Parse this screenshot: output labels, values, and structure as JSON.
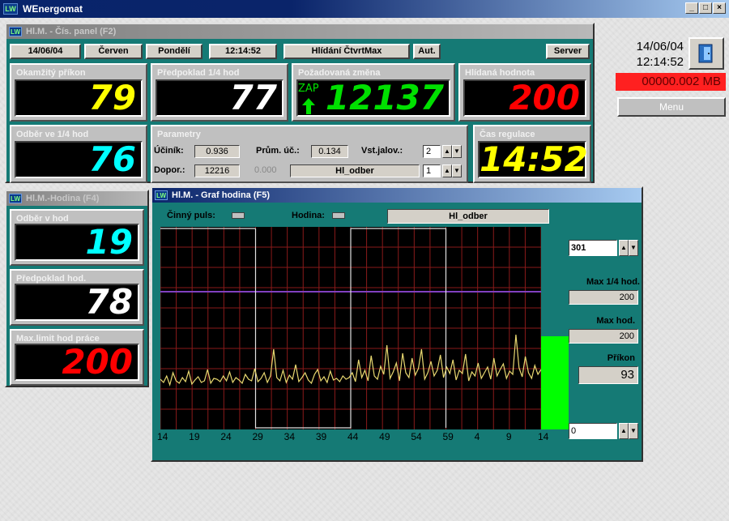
{
  "app": {
    "title": "WEnergomat",
    "icon": "LW",
    "window_controls": [
      "_",
      "□",
      "×"
    ]
  },
  "clock": {
    "date": "14/06/04",
    "time": "12:14:52"
  },
  "status": {
    "memory": "00000.002 MB"
  },
  "menu_label": "Menu",
  "panel1": {
    "title": "Hl.M. - Čís. panel (F2)",
    "header": {
      "date": "14/06/04",
      "month": "Červen",
      "day": "Pondělí",
      "time": "12:14:52",
      "mode": "Hlídání ČtvrtMax",
      "aut": "Aut.",
      "server": "Server"
    },
    "tiles": {
      "instant": {
        "label": "Okamžitý příkon",
        "value": "79",
        "color": "#ffff00"
      },
      "forecast": {
        "label": "Předpoklad 1/4 hod",
        "value": "77",
        "color": "#ffffff"
      },
      "required": {
        "label": "Požadovaná změna",
        "value": "12137",
        "color": "#00e000",
        "state": "ZAP"
      },
      "limit": {
        "label": "Hlídaná hodnota",
        "value": "200",
        "color": "#ff0000"
      },
      "consumption": {
        "label": "Odběr ve 1/4 hod",
        "value": "76",
        "color": "#00ffff"
      },
      "reg_time": {
        "label": "Čas regulace",
        "value": "14:52",
        "color": "#ffff00"
      }
    },
    "params": {
      "title": "Parametry",
      "pf_label": "Účiník:",
      "pf_value": "0.936",
      "avg_pf_label": "Prům. úč.:",
      "avg_pf_value": "0.134",
      "input_label": "Vst.jalov.:",
      "input_value": "2",
      "recommended_label": "Dopor.:",
      "recommended_value": "12216",
      "gray_value": "0.000",
      "source": "Hl_odber",
      "source_value": "1"
    }
  },
  "panel2": {
    "title": "Hl.M.-Hodina (F4)",
    "tiles": [
      {
        "label": "Odběr v hod",
        "value": "19",
        "color": "#00ffff"
      },
      {
        "label": "Předpoklad hod.",
        "value": "78",
        "color": "#ffffff"
      },
      {
        "label": "Max.limit hod práce",
        "value": "200",
        "color": "#ff0000"
      }
    ]
  },
  "panel3": {
    "title": "Hl.M. - Graf hodina (F5)",
    "active_pulse_label": "Činný puls:",
    "hour_label": "Hodina:",
    "source": "Hl_odber",
    "channel": "301",
    "max_quarter_label": "Max 1/4 hod.",
    "max_quarter_value": "200",
    "max_hour_label": "Max hod.",
    "max_hour_value": "200",
    "power_label": "Příkon",
    "power_value": "93",
    "bottom_value": "0",
    "bar_level_pct": 46
  },
  "chart_data": {
    "type": "line",
    "x_ticks": [
      "14",
      "19",
      "24",
      "29",
      "34",
      "39",
      "44",
      "49",
      "54",
      "59",
      "4",
      "9",
      "14"
    ],
    "ylim": [
      0,
      250
    ],
    "limit_line": 170,
    "grid": true,
    "series": [
      {
        "values": [
          62,
          58,
          66,
          55,
          70,
          60,
          57,
          64,
          59,
          72,
          56,
          61,
          65,
          58,
          60,
          74,
          57,
          63,
          62,
          59,
          66,
          60,
          71,
          58,
          64,
          61,
          57,
          68,
          62,
          60,
          75,
          59,
          63,
          70,
          58,
          66,
          99,
          64,
          60,
          73,
          58,
          67,
          62,
          80,
          59,
          64,
          70,
          61,
          57,
          68,
          74,
          60,
          65,
          58,
          72,
          61,
          63,
          59,
          66,
          62,
          64,
          70,
          59,
          86,
          64,
          73,
          60,
          91,
          66,
          62,
          78,
          68,
          104,
          63,
          71,
          82,
          60,
          94,
          70,
          64,
          88,
          67,
          75,
          99,
          62,
          70,
          84,
          66,
          73,
          92,
          64,
          77,
          69,
          86,
          61,
          73,
          69,
          93,
          60,
          71,
          66,
          82,
          63,
          70,
          77,
          62,
          88,
          66,
          74,
          81,
          63,
          72,
          68,
          117,
          76,
          65,
          90,
          70,
          63,
          79,
          68,
          74
        ]
      }
    ],
    "pulse_edges": [
      {
        "x_pos": 0.25,
        "from": 250,
        "to": 0
      },
      {
        "x_pos": 0.5,
        "from": 0,
        "to": 250
      },
      {
        "x_pos": 0.75,
        "from": 250,
        "to": 0
      }
    ]
  }
}
